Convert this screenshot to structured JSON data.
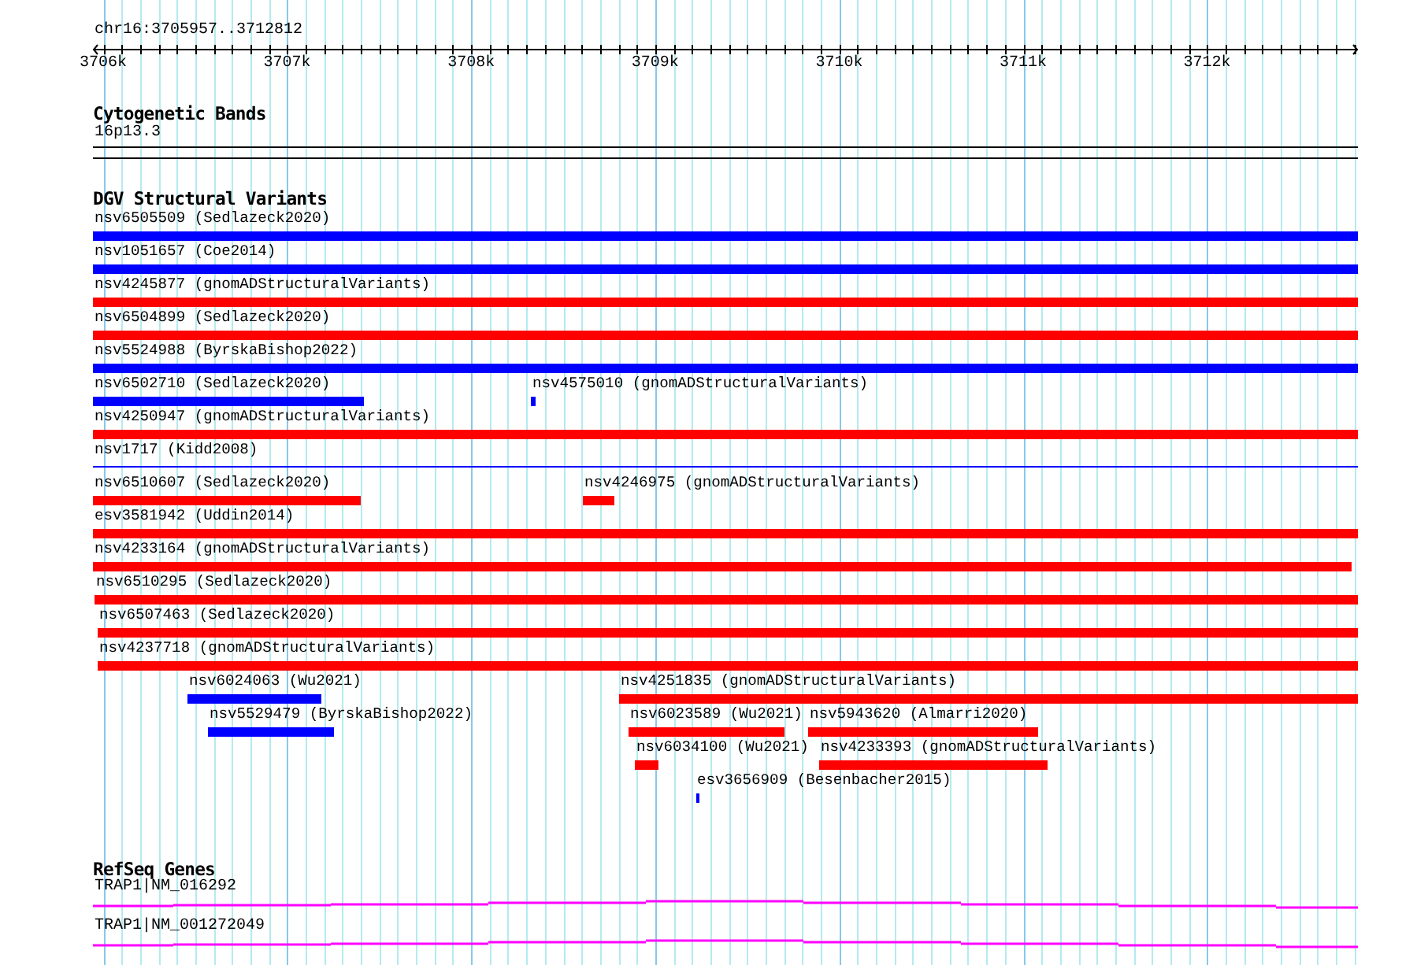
{
  "locus": "chr16:3705957..3712812",
  "ruler": {
    "ticks": [
      "3706k",
      "3707k",
      "3708k",
      "3709k",
      "3710k",
      "3711k",
      "3712k"
    ]
  },
  "tracks": [
    {
      "kind": "cytoband",
      "title": "Cytogenetic Bands",
      "band": "16p13.3"
    },
    {
      "kind": "variants",
      "title": "DGV Structural Variants",
      "rows": [
        [
          {
            "label": "nsv6505509 (Sedlazeck2020)",
            "color": "#0000ff"
          }
        ],
        [
          {
            "label": "nsv1051657 (Coe2014)",
            "color": "#0000ff"
          }
        ],
        [
          {
            "label": "nsv4245877 (gnomADStructuralVariants)",
            "color": "#ff0000"
          }
        ],
        [
          {
            "label": "nsv6504899 (Sedlazeck2020)",
            "color": "#ff0000"
          }
        ],
        [
          {
            "label": "nsv5524988 (ByrskaBishop2022)",
            "color": "#0000ff"
          }
        ],
        [
          {
            "label": "nsv6502710 (Sedlazeck2020)",
            "color": "#0000ff"
          },
          {
            "label": "nsv4575010 (gnomADStructuralVariants)",
            "color": "#0000ff"
          }
        ],
        [
          {
            "label": "nsv4250947 (gnomADStructuralVariants)",
            "color": "#ff0000"
          }
        ],
        [
          {
            "label": "nsv1717 (Kidd2008)",
            "color": "#0000ff"
          }
        ],
        [
          {
            "label": "nsv6510607 (Sedlazeck2020)",
            "color": "#ff0000"
          },
          {
            "label": "nsv4246975 (gnomADStructuralVariants)",
            "color": "#ff0000"
          }
        ],
        [
          {
            "label": "esv3581942 (Uddin2014)",
            "color": "#ff0000"
          }
        ],
        [
          {
            "label": "nsv4233164 (gnomADStructuralVariants)",
            "color": "#ff0000"
          }
        ],
        [
          {
            "label": "nsv6510295 (Sedlazeck2020)",
            "color": "#ff0000"
          }
        ],
        [
          {
            "label": "nsv6507463 (Sedlazeck2020)",
            "color": "#ff0000"
          }
        ],
        [
          {
            "label": "nsv4237718 (gnomADStructuralVariants)",
            "color": "#ff0000"
          }
        ],
        [
          {
            "label": "nsv6024063 (Wu2021)",
            "color": "#0000ff"
          },
          {
            "label": "nsv4251835 (gnomADStructuralVariants)",
            "color": "#ff0000"
          }
        ],
        [
          {
            "label": "nsv5529479 (ByrskaBishop2022)",
            "color": "#0000ff"
          },
          {
            "label": "nsv6023589 (Wu2021)",
            "color": "#ff0000"
          },
          {
            "label": "nsv5943620 (Almarri2020)",
            "color": "#ff0000"
          }
        ],
        [
          {
            "label": "nsv6034100 (Wu2021)",
            "color": "#ff0000"
          },
          {
            "label": "nsv4233393 (gnomADStructuralVariants)",
            "color": "#ff0000"
          }
        ],
        [
          {
            "label": "esv3656909 (Besenbacher2015)",
            "color": "#0000ff"
          }
        ]
      ]
    },
    {
      "kind": "genes",
      "title": "RefSeq Genes",
      "genes": [
        {
          "label": "TRAP1|NM_016292"
        },
        {
          "label": "TRAP1|NM_001272049"
        }
      ]
    }
  ]
}
